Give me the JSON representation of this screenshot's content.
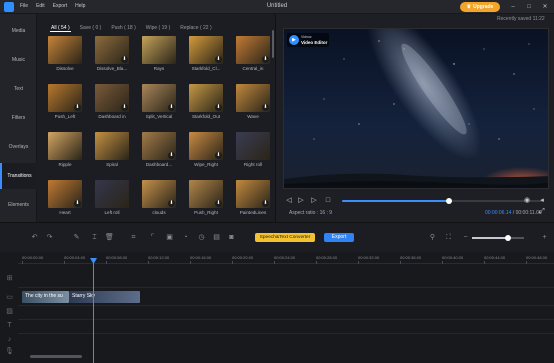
{
  "window": {
    "title": "Untitled",
    "menu": [
      "File",
      "Edit",
      "Export",
      "Help"
    ],
    "upgrade_label": "Upgrade",
    "saved_status": "Recently saved 11:22"
  },
  "sidebar": {
    "items": [
      {
        "label": "Media"
      },
      {
        "label": "Music"
      },
      {
        "label": "Text"
      },
      {
        "label": "Filters"
      },
      {
        "label": "Overlays"
      },
      {
        "label": "Transitions",
        "active": true
      },
      {
        "label": "Elements"
      }
    ]
  },
  "library": {
    "tabs": [
      "All ( 54 )",
      "Save ( 0 )",
      "Push ( 18 )",
      "Wipe ( 19 )",
      "Replace ( 22 )"
    ],
    "active_tab": 0,
    "tiles": [
      {
        "label": "Dissolve",
        "color": "#c6843a",
        "download": false
      },
      {
        "label": "Dissolve_Bla...",
        "color": "#8c6b3e",
        "download": true
      },
      {
        "label": "Rays",
        "color": "#c4a25a",
        "download": false
      },
      {
        "label": "Starkfold_Cl...",
        "color": "#d49b3c",
        "download": true
      },
      {
        "label": "Central_in",
        "color": "#c27b36",
        "download": true
      },
      {
        "label": "Push_Left",
        "color": "#b9782e",
        "download": true
      },
      {
        "label": "Dashboard in",
        "color": "#7a5a3a",
        "download": true
      },
      {
        "label": "Split_Vertical",
        "color": "#a8865a",
        "download": true
      },
      {
        "label": "Starkfold_Out",
        "color": "#c59945",
        "download": true
      },
      {
        "label": "Wave",
        "color": "#c1883e",
        "download": true
      },
      {
        "label": "Ripple",
        "color": "#d3a563",
        "download": false
      },
      {
        "label": "Spiral",
        "color": "#c49144",
        "download": false
      },
      {
        "label": "Dashboard...",
        "color": "#a27a4a",
        "download": true
      },
      {
        "label": "Wipe_Right",
        "color": "#c98b44",
        "download": true
      },
      {
        "label": "Right roll",
        "color": "#3a3d52",
        "download": false
      },
      {
        "label": "Heart",
        "color": "#c07a34",
        "download": true
      },
      {
        "label": "Left roll",
        "color": "#34374c",
        "download": false
      },
      {
        "label": "clouds",
        "color": "#c4914c",
        "download": true
      },
      {
        "label": "Push_Right",
        "color": "#b2864a",
        "download": true
      },
      {
        "label": "PaintedLines",
        "color": "#c38a3f",
        "download": true
      }
    ]
  },
  "preview": {
    "brand_small": "Vidnoz",
    "brand_big": "Video Editor",
    "aspect_label": "Aspect ratio : 16 : 9",
    "current_time": "00:00:06.14",
    "total_time": "00:00:11.00",
    "progress": 0.53
  },
  "toolbar": {
    "speech_label": "Speech&Text Converter",
    "export_label": "Export",
    "zoom_level": 0.7
  },
  "timeline": {
    "ticks": [
      "00:00:00.00",
      "00:00:04.00",
      "00:00:08.00",
      "00:00:12.00",
      "00:00:16.00",
      "00:00:20.00",
      "00:00:24.00",
      "00:00:28.00",
      "00:00:32.00",
      "00:00:36.00",
      "00:00:40.00",
      "00:00:44.00",
      "00:00:48.00"
    ],
    "clips": [
      {
        "label": "The city in the su",
        "color": "#3c5064"
      },
      {
        "label": "Starry Sky",
        "color": "#2d3a52"
      }
    ]
  },
  "colors": {
    "accent": "#3d8dfb",
    "upgrade": "#f3a42b",
    "speech_button": "#f2c230"
  }
}
